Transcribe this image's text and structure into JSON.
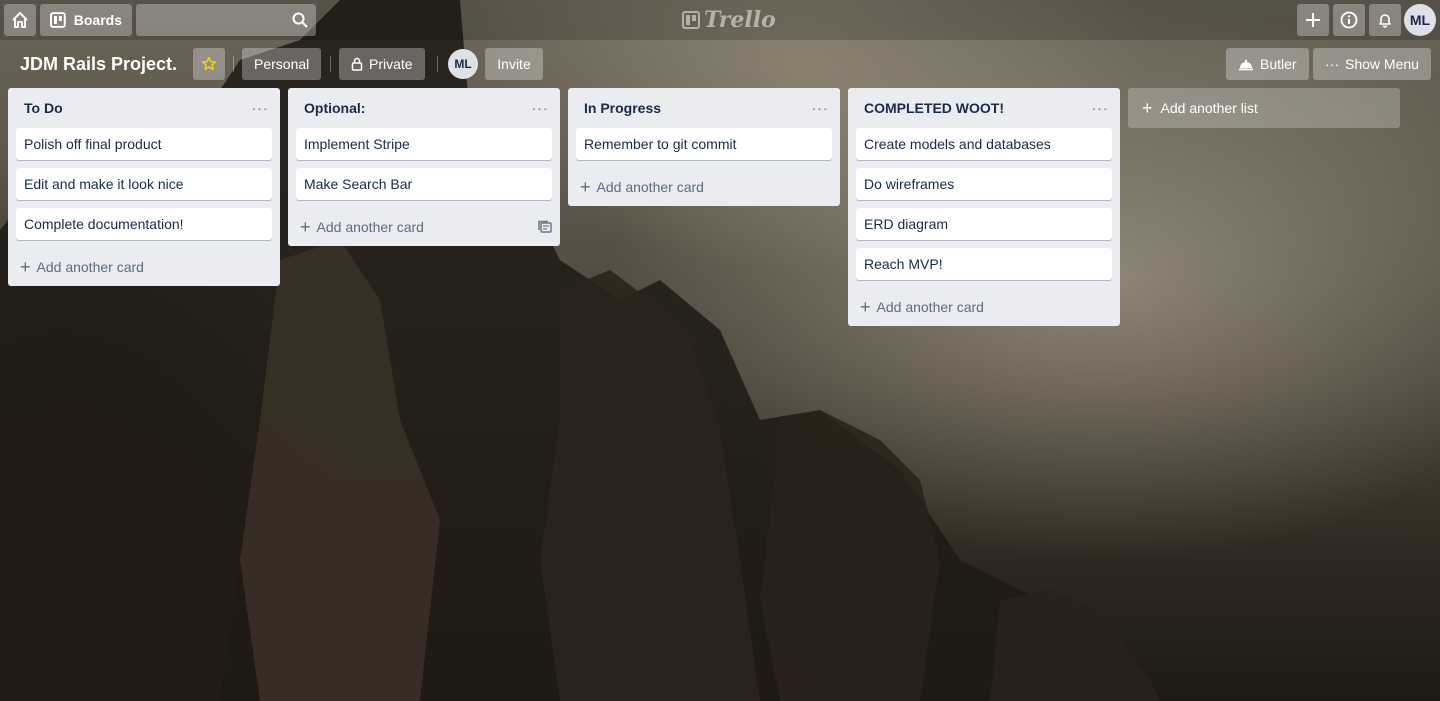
{
  "app": {
    "logo_text": "Trello"
  },
  "topbar": {
    "boards_label": "Boards",
    "search_placeholder": "",
    "avatar_initials": "ML"
  },
  "board": {
    "title": "JDM Rails Project.",
    "personal_label": "Personal",
    "private_label": "Private",
    "member_initials": "ML",
    "invite_label": "Invite",
    "butler_label": "Butler",
    "show_menu_label": "Show Menu"
  },
  "lists": [
    {
      "title": "To Do",
      "cards": [
        "Polish off final product",
        "Edit and make it look nice",
        "Complete documentation!"
      ],
      "add_card_label": "Add another card"
    },
    {
      "title": "Optional:",
      "cards": [
        "Implement Stripe",
        "Make Search Bar"
      ],
      "add_card_label": "Add another card"
    },
    {
      "title": "In Progress",
      "cards": [
        "Remember to git commit"
      ],
      "add_card_label": "Add another card"
    },
    {
      "title": "COMPLETED WOOT!",
      "cards": [
        "Create models and databases",
        "Do wireframes",
        "ERD diagram",
        "Reach MVP!"
      ],
      "add_card_label": "Add another card"
    }
  ],
  "add_list_label": "Add another list",
  "list_menu_glyph": "···",
  "add_glyph": "+",
  "colors": {
    "list_bg": "#ebecf0",
    "text": "#172b4d",
    "star": "#f2d600"
  }
}
